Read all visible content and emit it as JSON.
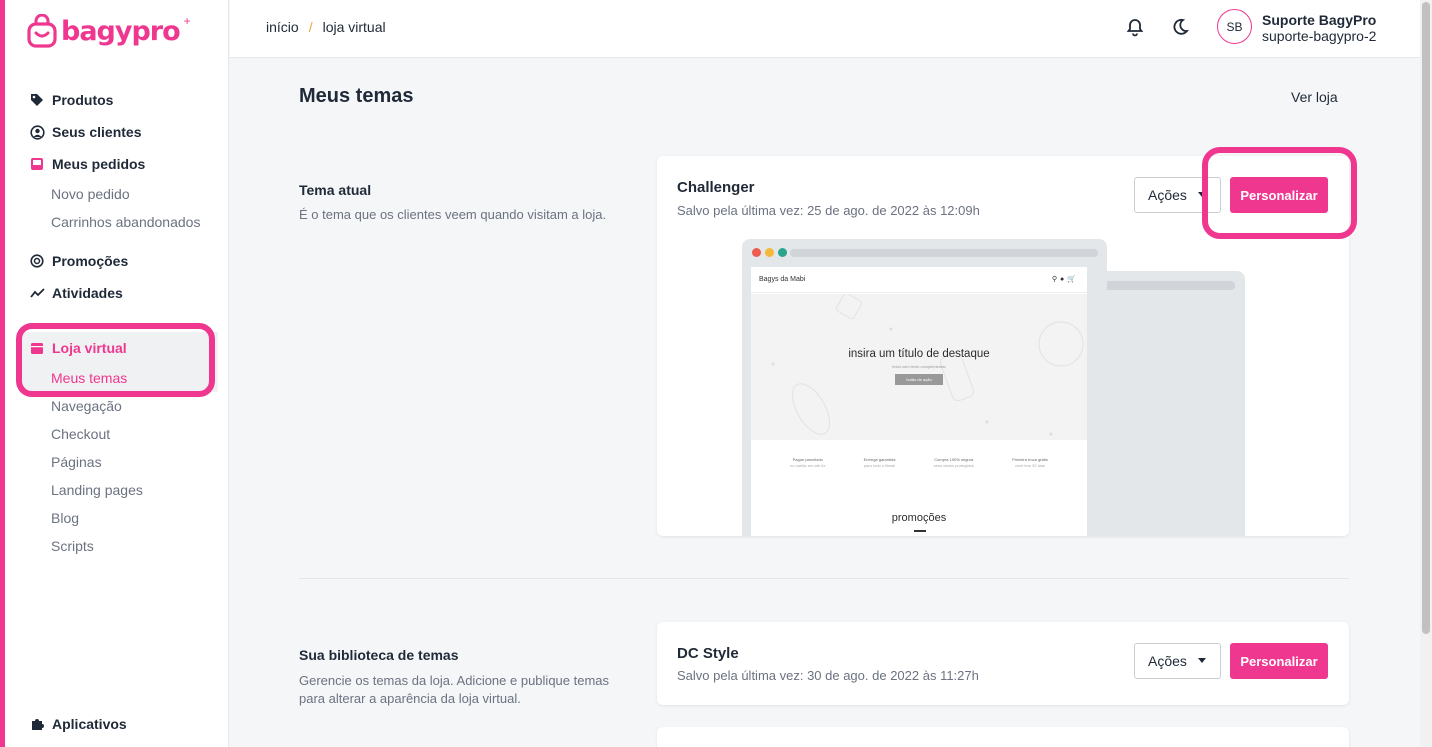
{
  "brand": {
    "logo_text": "bagypro",
    "accent": "#f0378f"
  },
  "sidebar": {
    "items": [
      {
        "label": "Produtos",
        "icon": "tag-icon"
      },
      {
        "label": "Seus clientes",
        "icon": "user-circle-icon"
      },
      {
        "label": "Meus pedidos",
        "icon": "inbox-icon",
        "sub": [
          "Novo pedido",
          "Carrinhos abandonados"
        ]
      },
      {
        "label": "Promoções",
        "icon": "percent-badge-icon"
      },
      {
        "label": "Atividades",
        "icon": "trend-chart-icon"
      },
      {
        "label": "Loja virtual",
        "icon": "storefront-icon",
        "sub": [
          "Meus temas",
          "Navegação",
          "Checkout",
          "Páginas",
          "Landing pages",
          "Blog",
          "Scripts"
        ]
      }
    ],
    "bottom": {
      "label": "Aplicativos",
      "icon": "puzzle-icon"
    }
  },
  "header": {
    "breadcrumb": [
      "início",
      "/",
      "loja virtual"
    ],
    "avatar_initials": "SB",
    "user_name": "Suporte BagyPro",
    "user_handle": "suporte-bagypro-2"
  },
  "main": {
    "title": "Meus temas",
    "ver_loja": "Ver loja",
    "current": {
      "section_title": "Tema atual",
      "section_desc": "É o tema que os clientes veem quando visitam a loja.",
      "theme_name": "Challenger",
      "saved": "Salvo pela última vez: 25 de ago. de 2022 às 12:09h",
      "acoes": "Ações",
      "personalizar": "Personalizar"
    },
    "preview": {
      "store_name": "Bagys da Mabi",
      "hero_title": "insira um título de destaque",
      "hero_sub": "texto com texto complementar",
      "hero_btn": "botão de ação",
      "features": [
        {
          "t": "Pague parcelado",
          "s": "no cartão em até 6x"
        },
        {
          "t": "Entrega garantida",
          "s": "para todo o Brasil"
        },
        {
          "t": "Compra 100% segura",
          "s": "seus dados protegidos"
        },
        {
          "t": "Primeira troca grátis",
          "s": "você tem 30 dias"
        }
      ],
      "promo_title": "promoções"
    },
    "library": {
      "section_title": "Sua biblioteca de temas",
      "section_desc": "Gerencie os temas da loja. Adicione e publique temas para alterar a aparência da loja virtual.",
      "theme_name": "DC Style",
      "saved": "Salvo pela última vez: 30 de ago. de 2022 às 11:27h",
      "acoes": "Ações",
      "personalizar": "Personalizar"
    }
  }
}
